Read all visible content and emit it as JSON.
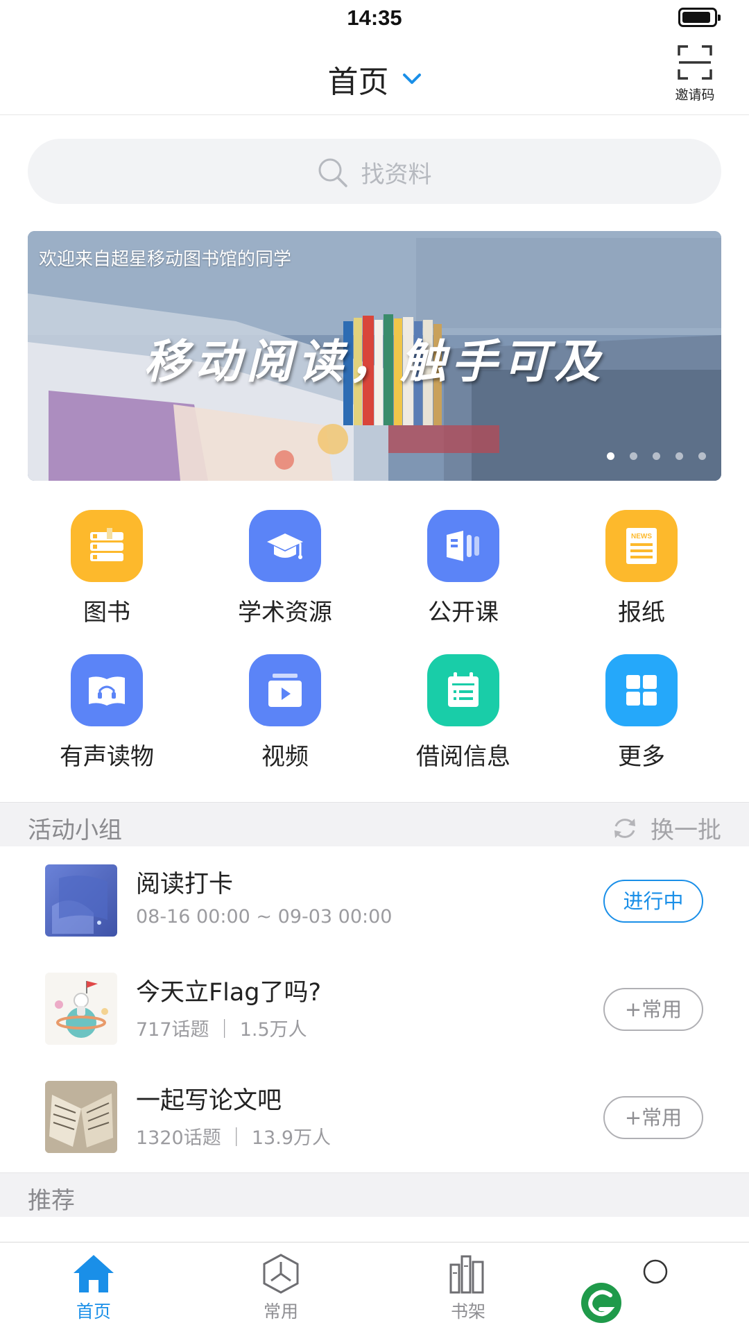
{
  "status_bar": {
    "time": "14:35"
  },
  "header": {
    "title": "首页",
    "invite_label": "邀请码"
  },
  "search": {
    "placeholder": "找资料"
  },
  "banner": {
    "subtitle": "欢迎来自超星移动图书馆的同学",
    "title": "移动阅读，触手可及",
    "dots": 5,
    "active_dot": 0
  },
  "grid": {
    "items": [
      {
        "label": "图书",
        "icon": "books-icon",
        "color": "#FDB92C"
      },
      {
        "label": "学术资源",
        "icon": "graduation-cap-icon",
        "color": "#5B84F7"
      },
      {
        "label": "公开课",
        "icon": "open-course-icon",
        "color": "#5B84F7"
      },
      {
        "label": "报纸",
        "icon": "newspaper-icon",
        "color": "#FDB92C"
      },
      {
        "label": "有声读物",
        "icon": "audiobook-icon",
        "color": "#5B84F7"
      },
      {
        "label": "视频",
        "icon": "video-icon",
        "color": "#5B84F7"
      },
      {
        "label": "借阅信息",
        "icon": "calendar-icon",
        "color": "#19CDA8"
      },
      {
        "label": "更多",
        "icon": "more-grid-icon",
        "color": "#25A8FA"
      }
    ],
    "newspaper_text": "NEWS"
  },
  "activity": {
    "title": "活动小组",
    "refresh_label": "换一批",
    "groups": [
      {
        "name": "阅读打卡",
        "meta": "08-16 00:00 ~ 09-03 00:00",
        "action": "进行中"
      },
      {
        "name": "今天立Flag了吗?",
        "meta": "717话题 ｜ 1.5万人",
        "action": "+常用"
      },
      {
        "name": "一起写论文吧",
        "meta": "1320话题 ｜ 13.9万人",
        "action": "+常用"
      }
    ]
  },
  "recommend": {
    "title": "推荐"
  },
  "tabbar": {
    "tabs": [
      {
        "label": "首页",
        "icon": "home-icon",
        "active": true
      },
      {
        "label": "常用",
        "icon": "hexagon-icon",
        "active": false
      },
      {
        "label": "书架",
        "icon": "bookshelf-icon",
        "active": false
      }
    ]
  },
  "colors": {
    "accent": "#1A8FE8",
    "yellow": "#FDB92C",
    "indigo": "#5B84F7",
    "teal": "#19CDA8",
    "sky": "#25A8FA"
  }
}
